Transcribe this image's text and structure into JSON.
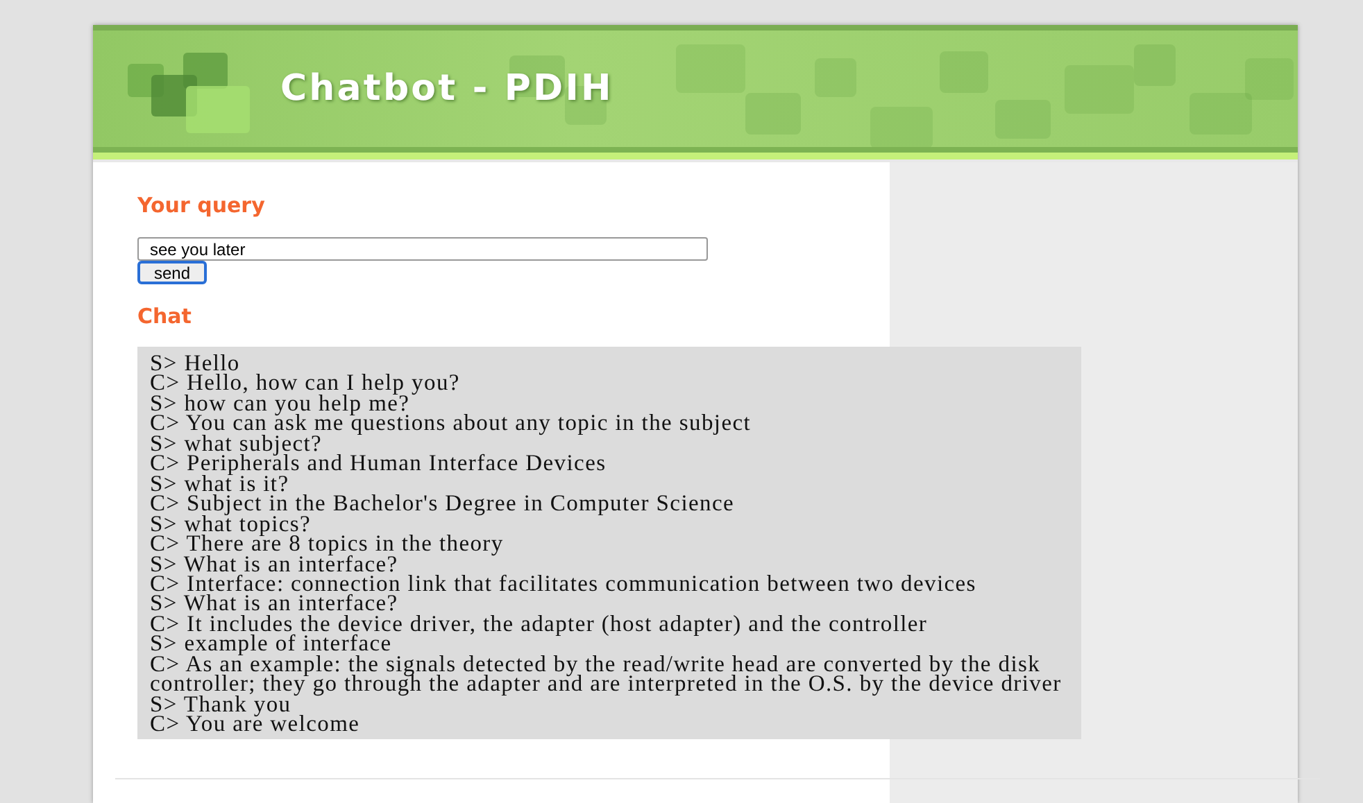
{
  "header": {
    "title": "Chatbot - PDIH"
  },
  "query": {
    "heading": "Your query",
    "value": "see you later",
    "button": "send"
  },
  "chat": {
    "heading": "Chat",
    "lines": [
      "S> Hello",
      "C> Hello, how can I help you?",
      "S> how can you help me?",
      "C> You can ask me questions about any topic in the subject",
      "S> what subject?",
      "C> Peripherals and Human Interface Devices",
      "S> what is it?",
      "C> Subject in the Bachelor's Degree in Computer Science",
      "S> what topics?",
      "C> There are 8 topics in the theory",
      "S> What is an interface?",
      "C> Interface: connection link that facilitates communication between two devices",
      "S> What is an interface?",
      "C> It includes the device driver, the adapter (host adapter) and the controller",
      "S> example of interface",
      "C> As an example: the signals detected by the read/write head are converted by the disk controller; they go through the adapter and are interpreted in the O.S. by the device driver",
      "S> Thank you",
      "C> You are welcome"
    ]
  }
}
